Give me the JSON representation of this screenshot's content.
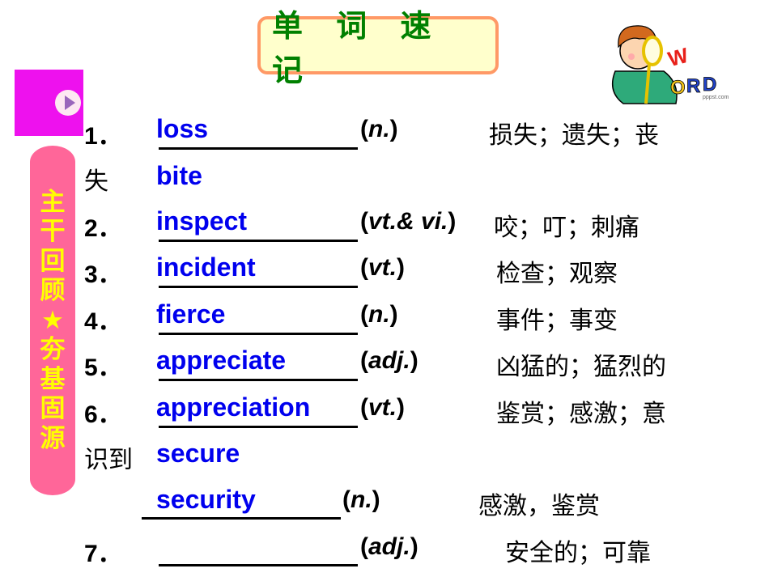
{
  "title": "单 词 速 记",
  "clipart": {
    "icon": "boy-with-magnifier-word-clipart",
    "letters": [
      "W",
      "O",
      "R",
      "D"
    ],
    "watermark": "pppst.com"
  },
  "nav": {
    "button_icon": "play-icon"
  },
  "side_banner": {
    "chars": [
      "主",
      "干",
      "回",
      "顾",
      "★",
      "夯",
      "基",
      "固",
      "源"
    ]
  },
  "items": [
    {
      "number": "1．",
      "answer": "loss",
      "pos_prefix": "(",
      "pos": "n.",
      "pos_suffix": ")",
      "meaning": "损失；遗失；丧",
      "meaning_cont": "失"
    },
    {
      "number": "",
      "answer": "bite",
      "pos": "",
      "meaning": ""
    },
    {
      "number": "2．",
      "answer": "inspect",
      "pos_prefix": "(",
      "pos": "vt.& vi.",
      "pos_suffix": ")",
      "meaning": "咬；叮；刺痛"
    },
    {
      "number": "3．",
      "answer": "incident",
      "pos_prefix": "(",
      "pos": "vt.",
      "pos_suffix": ")",
      "meaning": "检查；观察"
    },
    {
      "number": "4．",
      "answer": "fierce",
      "pos_prefix": "(",
      "pos": "n.",
      "pos_suffix": ")",
      "meaning": "事件；事变"
    },
    {
      "number": "5．",
      "answer": "appreciate",
      "pos_prefix": "(",
      "pos": "adj.",
      "pos_suffix": ")",
      "meaning": "凶猛的；猛烈的"
    },
    {
      "number": "6．",
      "answer": "appreciation",
      "pos_prefix": "(",
      "pos": "vt.",
      "pos_suffix": ")",
      "meaning": "鉴赏；感激；意",
      "meaning_cont": "识到"
    },
    {
      "number": "",
      "answer": "secure",
      "pos": "",
      "meaning": ""
    },
    {
      "number": "",
      "answer": "security",
      "pos_prefix": "(",
      "pos": "n.",
      "pos_suffix": ")",
      "meaning": "感激，鉴赏"
    },
    {
      "number": "7．",
      "answer": "",
      "pos_prefix": "(",
      "pos": "adj.",
      "pos_suffix": ")",
      "meaning": "安全的；可靠"
    }
  ]
}
